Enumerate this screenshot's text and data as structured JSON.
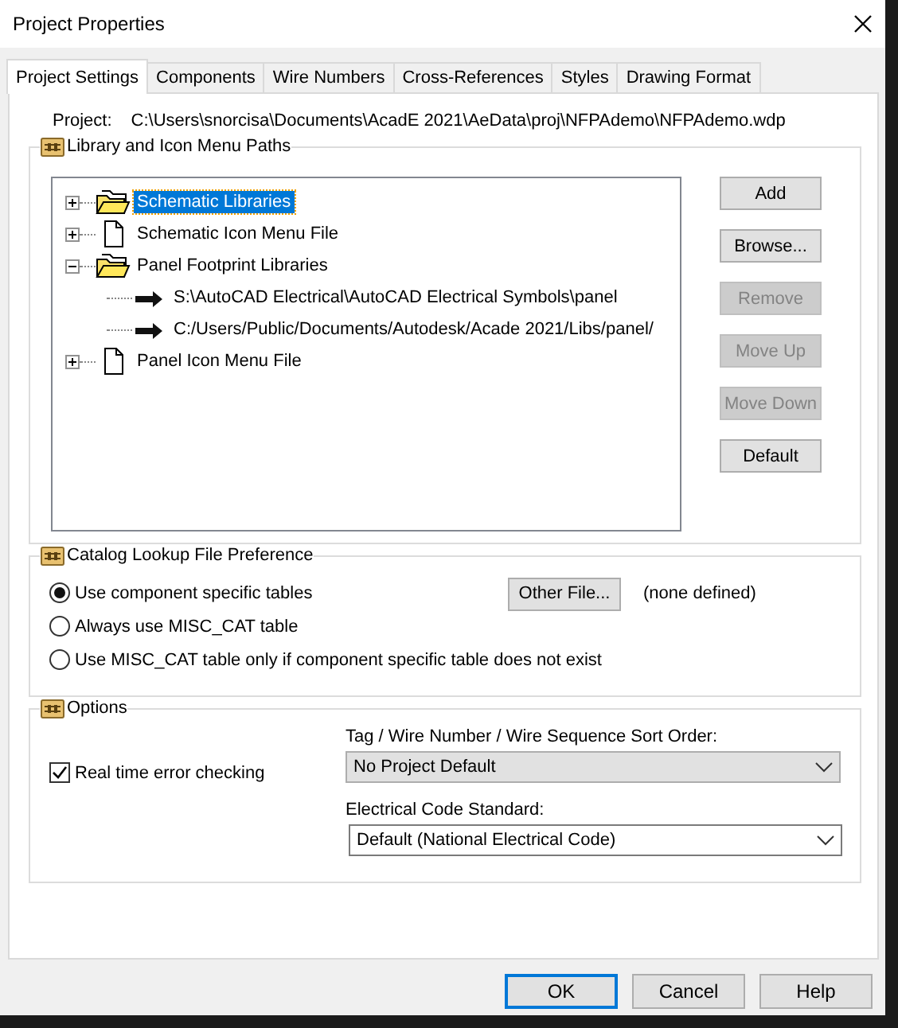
{
  "window": {
    "title": "Project Properties"
  },
  "tabs": [
    {
      "label": "Project Settings",
      "selected": true
    },
    {
      "label": "Components",
      "selected": false
    },
    {
      "label": "Wire Numbers",
      "selected": false
    },
    {
      "label": "Cross-References",
      "selected": false
    },
    {
      "label": "Styles",
      "selected": false
    },
    {
      "label": "Drawing Format",
      "selected": false
    }
  ],
  "project": {
    "label": "Project:",
    "path": "C:\\Users\\snorcisa\\Documents\\AcadE 2021\\AeData\\proj\\NFPAdemo\\NFPAdemo.wdp"
  },
  "library_paths": {
    "title": "Library and Icon Menu Paths",
    "tree": [
      {
        "label": "Schematic Libraries",
        "kind": "folder",
        "expanded": false,
        "selected": true
      },
      {
        "label": "Schematic Icon Menu File",
        "kind": "file",
        "expanded": false,
        "selected": false
      },
      {
        "label": "Panel Footprint Libraries",
        "kind": "folder",
        "expanded": true,
        "selected": false,
        "children": [
          {
            "label": "S:\\AutoCAD Electrical\\AutoCAD Electrical Symbols\\panel",
            "kind": "path",
            "selected": false
          },
          {
            "label": "C:/Users/Public/Documents/Autodesk/Acade 2021/Libs/panel/",
            "kind": "path",
            "selected": false
          }
        ]
      },
      {
        "label": "Panel Icon Menu File",
        "kind": "file",
        "expanded": false,
        "selected": false
      }
    ],
    "buttons": [
      {
        "label": "Add",
        "disabled": false
      },
      {
        "label": "Browse...",
        "disabled": false
      },
      {
        "label": "Remove",
        "disabled": true
      },
      {
        "label": "Move Up",
        "disabled": true
      },
      {
        "label": "Move Down",
        "disabled": true
      },
      {
        "label": "Default",
        "disabled": false
      }
    ]
  },
  "catalog_lookup": {
    "title": "Catalog Lookup File Preference",
    "options": [
      {
        "label": "Use component specific tables",
        "selected": true
      },
      {
        "label": "Always use MISC_CAT table",
        "selected": false
      },
      {
        "label": "Use MISC_CAT table only if component specific table does not exist",
        "selected": false
      }
    ],
    "other_file_button": "Other File...",
    "other_file_value": "(none defined)"
  },
  "options": {
    "title": "Options",
    "real_time_error_checking": {
      "label": "Real time error checking",
      "checked": true
    },
    "sort_order": {
      "label": "Tag / Wire Number / Wire Sequence Sort Order:",
      "value": "No Project Default"
    },
    "code_standard": {
      "label": "Electrical Code Standard:",
      "value": "Default (National Electrical Code)"
    }
  },
  "footer_buttons": [
    {
      "label": "OK",
      "default": true
    },
    {
      "label": "Cancel",
      "default": false
    },
    {
      "label": "Help",
      "default": false
    }
  ]
}
